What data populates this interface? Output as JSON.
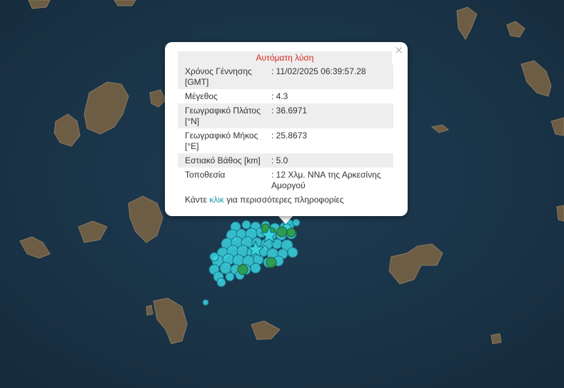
{
  "popup": {
    "title": "Αυτόματη λύση",
    "close_symbol": "×",
    "rows": [
      {
        "label": "Χρόνος Γέννησης [GMT]",
        "value": ": 11/02/2025 06:39:57.28"
      },
      {
        "label": "Μέγεθος",
        "value": ": 4.3"
      },
      {
        "label": "Γεωγραφικό Πλάτος [°N]",
        "value": ": 36.6971"
      },
      {
        "label": "Γεωγραφικό Μήκος [°E]",
        "value": ": 25.8673"
      },
      {
        "label": "Εστιακό Βάθος [km]",
        "value": ": 5.0"
      },
      {
        "label": "Τοποθεσία",
        "value": ": 12 Χλμ. ΝΝΑ της Αρκεσίνης Αμοργού"
      }
    ],
    "more_prefix": "Κάντε ",
    "more_link": "κλικ",
    "more_suffix": " για περισσότερες πληροφορίες"
  },
  "map": {
    "sea_color": "#1a3347",
    "land_color": "#6a5a43",
    "recent_marker_color": "#3ad3df",
    "older_marker_color": "#2e9a47",
    "star_icon": "star-icon"
  }
}
